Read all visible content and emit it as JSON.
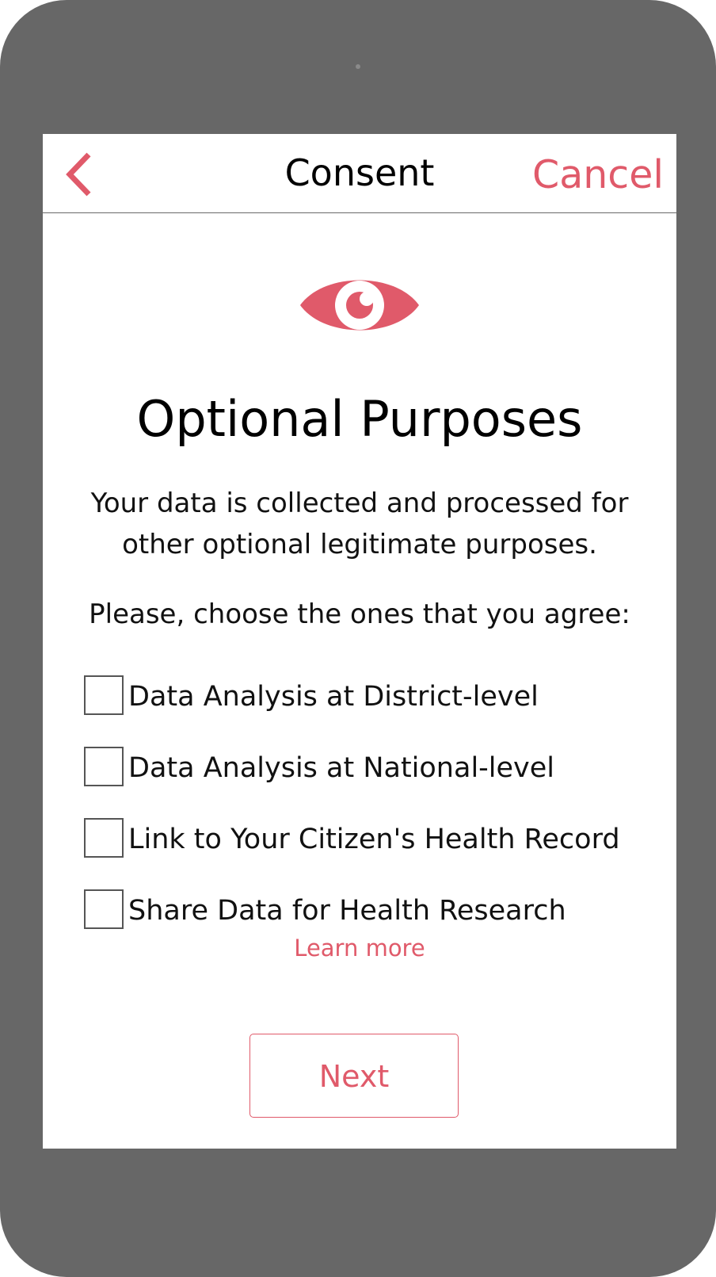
{
  "nav": {
    "title": "Consent",
    "cancel_label": "Cancel",
    "back_icon": "chevron-left-icon"
  },
  "hero": {
    "icon": "eye-icon",
    "heading": "Optional Purposes",
    "description": "Your data is collected and processed for other optional legitimate purposes."
  },
  "prompt": "Please, choose the ones that you agree:",
  "options": [
    {
      "label": "Data Analysis at District-level",
      "checked": false
    },
    {
      "label": "Data Analysis at National-level",
      "checked": false
    },
    {
      "label": "Link to Your Citizen's Health Record",
      "checked": false
    },
    {
      "label": "Share Data for Health Research",
      "checked": false
    }
  ],
  "learn_more_label": "Learn more",
  "next_label": "Next",
  "colors": {
    "accent": "#e05a6a",
    "device_frame": "#676767",
    "screen_background": "#ffffff"
  }
}
